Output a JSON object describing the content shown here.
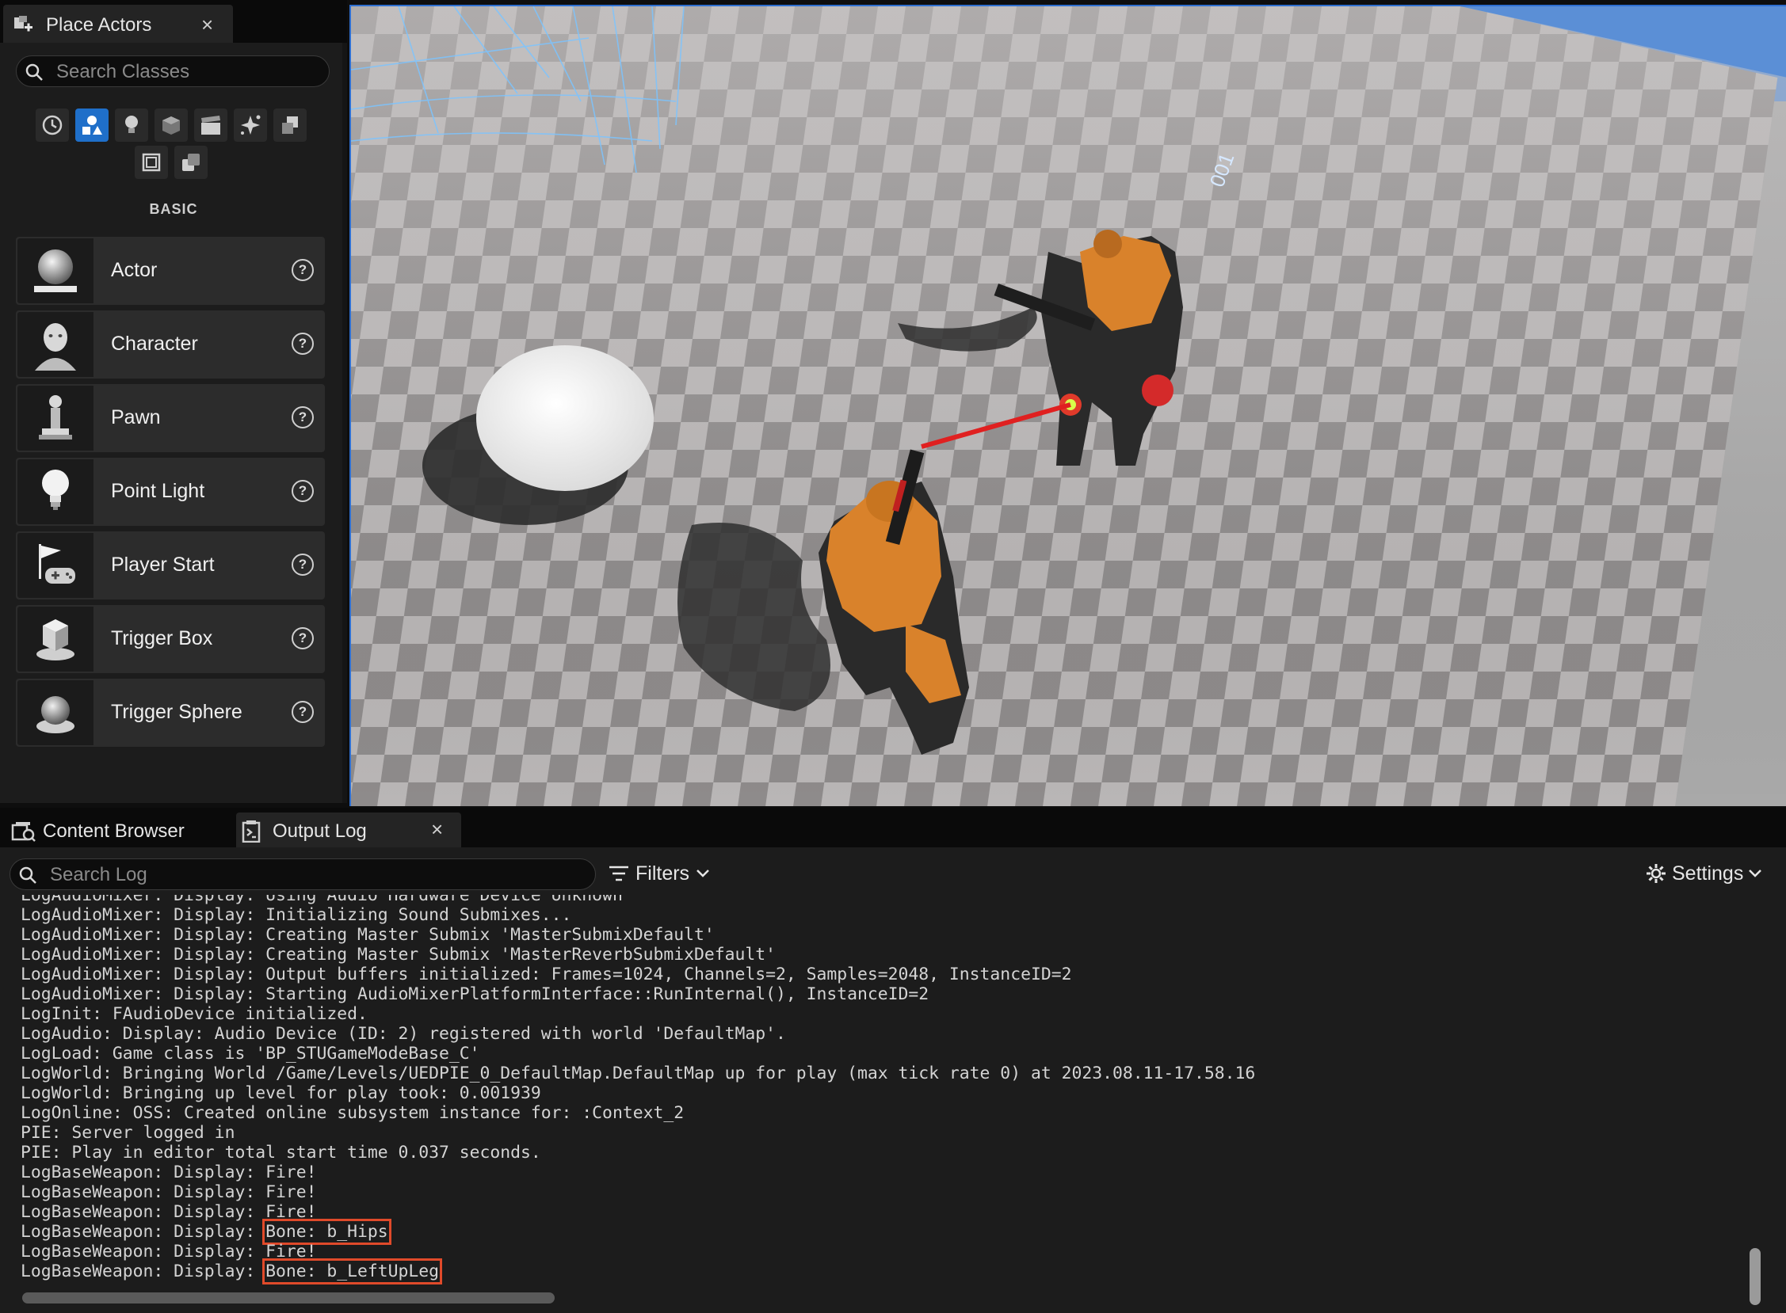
{
  "place_actors": {
    "tab_title": "Place Actors",
    "close_glyph": "×",
    "search_placeholder": "Search Classes",
    "category_icons": [
      "recent-clock-icon",
      "basic-shapes-icon",
      "lights-icon",
      "cinematic-cube-icon",
      "clapperboard-icon",
      "visual-effects-icon",
      "geometry-icon",
      "volumes-icon",
      "all-classes-icon"
    ],
    "active_category": "basic-shapes-icon",
    "section_label": "BASIC",
    "items": [
      {
        "label": "Actor",
        "icon": "actor-sphere-icon"
      },
      {
        "label": "Character",
        "icon": "character-head-icon"
      },
      {
        "label": "Pawn",
        "icon": "pawn-icon"
      },
      {
        "label": "Point Light",
        "icon": "light-bulb-icon"
      },
      {
        "label": "Player Start",
        "icon": "player-start-flag-icon"
      },
      {
        "label": "Trigger Box",
        "icon": "trigger-box-icon"
      },
      {
        "label": "Trigger Sphere",
        "icon": "trigger-sphere-icon"
      }
    ],
    "help_glyph": "?"
  },
  "viewport": {
    "floor_text": "001",
    "colors": {
      "sky": "#5b8fd6",
      "floor_light": "#b9b6b6",
      "floor_dark": "#8e8b8b",
      "trace": "#e02020",
      "armor": "#d9822b"
    }
  },
  "bottom_tabs": {
    "content_browser": "Content Browser",
    "output_log": "Output Log",
    "close_glyph": "×"
  },
  "log_toolbar": {
    "search_placeholder": "Search Log",
    "filters_label": "Filters",
    "settings_label": "Settings"
  },
  "log": {
    "lines": [
      {
        "prefix": "LogAudioMixer: Display: Using Audio Hardware Device Unknown",
        "highlight": ""
      },
      {
        "prefix": "LogAudioMixer: Display: Initializing Sound Submixes...",
        "highlight": ""
      },
      {
        "prefix": "LogAudioMixer: Display: Creating Master Submix 'MasterSubmixDefault'",
        "highlight": ""
      },
      {
        "prefix": "LogAudioMixer: Display: Creating Master Submix 'MasterReverbSubmixDefault'",
        "highlight": ""
      },
      {
        "prefix": "LogAudioMixer: Display: Output buffers initialized: Frames=1024, Channels=2, Samples=2048, InstanceID=2",
        "highlight": ""
      },
      {
        "prefix": "LogAudioMixer: Display: Starting AudioMixerPlatformInterface::RunInternal(), InstanceID=2",
        "highlight": ""
      },
      {
        "prefix": "LogInit: FAudioDevice initialized.",
        "highlight": ""
      },
      {
        "prefix": "LogAudio: Display: Audio Device (ID: 2) registered with world 'DefaultMap'.",
        "highlight": ""
      },
      {
        "prefix": "LogLoad: Game class is 'BP_STUGameModeBase_C'",
        "highlight": ""
      },
      {
        "prefix": "LogWorld: Bringing World /Game/Levels/UEDPIE_0_DefaultMap.DefaultMap up for play (max tick rate 0) at 2023.08.11-17.58.16",
        "highlight": ""
      },
      {
        "prefix": "LogWorld: Bringing up level for play took: 0.001939",
        "highlight": ""
      },
      {
        "prefix": "LogOnline: OSS: Created online subsystem instance for: :Context_2",
        "highlight": ""
      },
      {
        "prefix": "PIE: Server logged in",
        "highlight": ""
      },
      {
        "prefix": "PIE: Play in editor total start time 0.037 seconds.",
        "highlight": ""
      },
      {
        "prefix": "LogBaseWeapon: Display: Fire!",
        "highlight": ""
      },
      {
        "prefix": "LogBaseWeapon: Display: Fire!",
        "highlight": ""
      },
      {
        "prefix": "LogBaseWeapon: Display: Fire!",
        "highlight": ""
      },
      {
        "prefix": "LogBaseWeapon: Display: ",
        "highlight": "Bone: b_Hips"
      },
      {
        "prefix": "LogBaseWeapon: Display: Fire!",
        "highlight": ""
      },
      {
        "prefix": "LogBaseWeapon: Display: ",
        "highlight": "Bone: b_LeftUpLeg"
      }
    ]
  }
}
